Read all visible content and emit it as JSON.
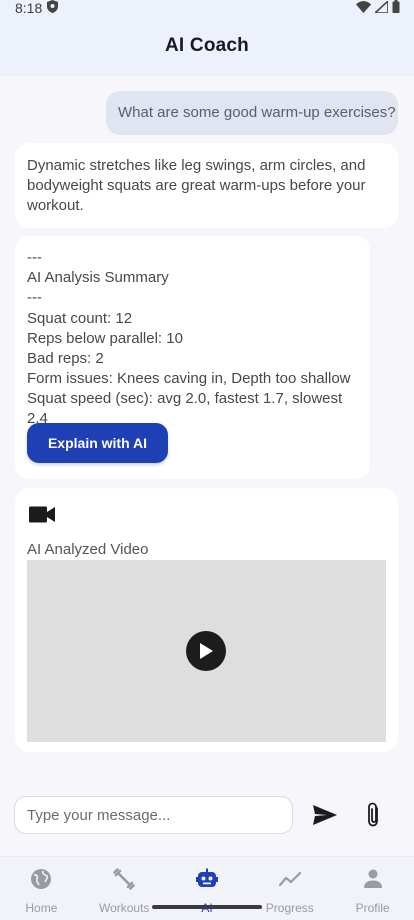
{
  "status_bar": {
    "time": "8:18",
    "icons": [
      "shield-icon",
      "wifi-icon",
      "signal-icon",
      "battery-icon"
    ]
  },
  "app_bar": {
    "title": "AI Coach"
  },
  "chat": {
    "user_message": "What are some good warm-up exercises?",
    "ai_reply": "Dynamic stretches like leg swings, arm circles, and bodyweight squats are great warm-ups before your workout.",
    "summary": {
      "lines": [
        "---",
        "AI Analysis Summary",
        "---",
        "Squat count: 12",
        "Reps below parallel: 10",
        "Bad reps: 2",
        "Form issues: Knees caving in, Depth too shallow",
        "Squat speed (sec): avg 2.0, fastest 1.7, slowest 2.4"
      ],
      "explain_button_label": "Explain with AI"
    },
    "video": {
      "icon": "videocam-icon",
      "label": "AI Analyzed Video",
      "play_icon": "play-icon"
    }
  },
  "composer": {
    "placeholder": "Type your message...",
    "send_icon": "send-icon",
    "attach_icon": "paperclip-icon"
  },
  "bottom_nav": {
    "active": "AI",
    "items": [
      {
        "label": "Home",
        "icon": "globe-icon"
      },
      {
        "label": "Workouts",
        "icon": "dumbbell-icon"
      },
      {
        "label": "AI",
        "icon": "robot-icon"
      },
      {
        "label": "Progress",
        "icon": "trend-icon"
      },
      {
        "label": "Profile",
        "icon": "person-icon"
      }
    ]
  },
  "colors": {
    "accent": "#1e40b4",
    "user_bubble": "#e1e4f1",
    "header_bg": "#edf1fb",
    "page_bg": "#f6f6fb"
  }
}
